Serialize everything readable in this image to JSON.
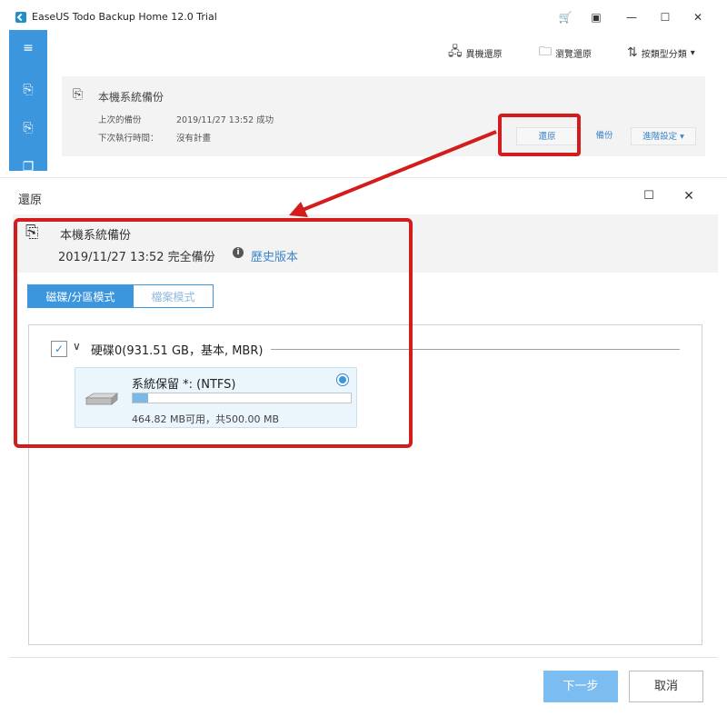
{
  "app": {
    "title": "EaseUS Todo Backup Home 12.0 Trial",
    "accent_color": "#3b96dd",
    "annotation_color": "#d41c1c"
  },
  "window_controls": {
    "cart": "\u0001F6D2",
    "minimize": "—",
    "maximize": "☐",
    "close": "✕"
  },
  "toolbar": {
    "remote_restore": "異機還原",
    "browse_restore": "瀏覽還原",
    "sort_by_type": "按類型分類"
  },
  "task": {
    "name": "本機系統備份",
    "last_backup_label": "上次的備份",
    "last_backup_value": "2019/11/27 13:52 成功",
    "next_run_label": "下次執行時間：",
    "next_run_value": "沒有計畫",
    "restore_label": "還原",
    "backup_label": "備份",
    "advanced_label": "進階設定"
  },
  "dialog": {
    "title": "還原",
    "backup_name": "本機系統備份",
    "backup_time": "2019/11/27 13:52 完全備份",
    "history_link": "歷史版本",
    "tabs": [
      {
        "label": "磁碟/分區模式",
        "active": true
      },
      {
        "label": "檔案模式",
        "active": false
      }
    ],
    "disk": {
      "checked": true,
      "label": "硬碟0(931.51 GB，基本, MBR)"
    },
    "partition": {
      "name": "系統保留 *: (NTFS)",
      "selected": true,
      "used_fraction": 0.07,
      "size_text": "464.82 MB可用，共500.00 MB"
    },
    "next_label": "下一步",
    "cancel_label": "取消"
  }
}
